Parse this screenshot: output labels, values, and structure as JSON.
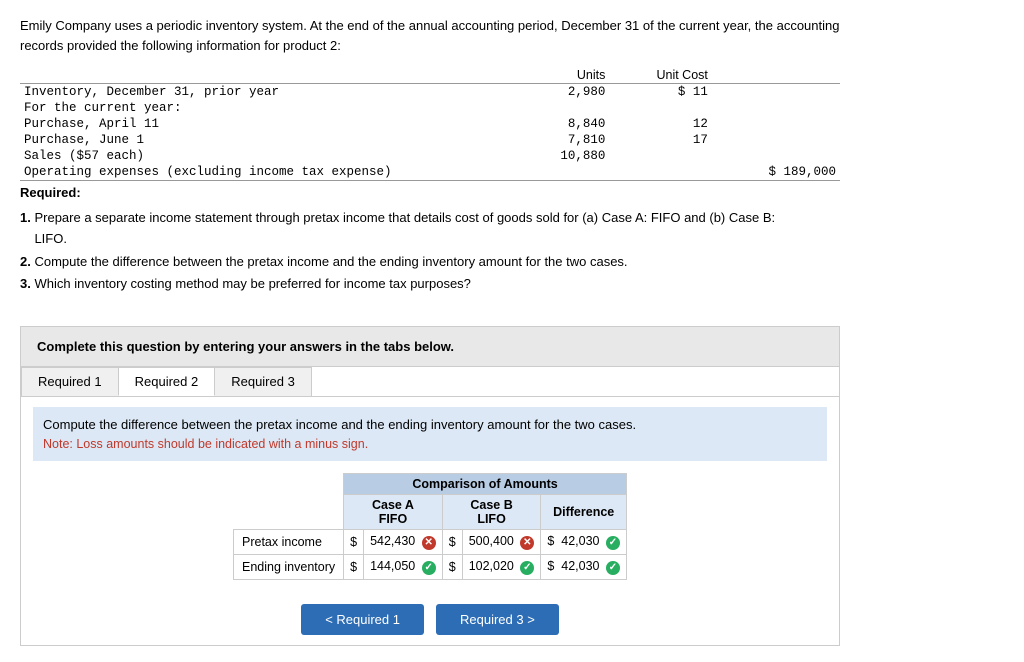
{
  "intro": {
    "text": "Emily Company uses a periodic inventory system. At the end of the annual accounting period, December 31 of the current year, the accounting records provided the following information for product 2:"
  },
  "data_table": {
    "headers": [
      "",
      "Units",
      "Unit Cost"
    ],
    "rows": [
      {
        "label": "Inventory, December 31, prior year",
        "indent": 0,
        "units": "2,980",
        "cost": "$ 11",
        "amount": ""
      },
      {
        "label": "For the current year:",
        "indent": 0,
        "units": "",
        "cost": "",
        "amount": ""
      },
      {
        "label": "Purchase, April 11",
        "indent": 2,
        "units": "8,840",
        "cost": "12",
        "amount": ""
      },
      {
        "label": "Purchase, June 1",
        "indent": 2,
        "units": "7,810",
        "cost": "17",
        "amount": ""
      },
      {
        "label": "Sales ($57 each)",
        "indent": 2,
        "units": "10,880",
        "cost": "",
        "amount": ""
      },
      {
        "label": "Operating expenses (excluding income tax expense)",
        "indent": 2,
        "units": "",
        "cost": "",
        "amount": "$ 189,000"
      }
    ]
  },
  "required_label": "Required:",
  "instructions": [
    {
      "num": "1",
      "text": "Prepare a separate income statement through pretax income that details cost of goods sold for (a) Case A: FIFO and (b) Case B: LIFO."
    },
    {
      "num": "2",
      "text": "Compute the difference between the pretax income and the ending inventory amount for the two cases."
    },
    {
      "num": "3",
      "text": "Which inventory costing method may be preferred for income tax purposes?"
    }
  ],
  "complete_box": {
    "text": "Complete this question by entering your answers in the tabs below."
  },
  "tabs": [
    {
      "label": "Required 1",
      "active": false
    },
    {
      "label": "Required 2",
      "active": true
    },
    {
      "label": "Required 3",
      "active": false
    }
  ],
  "tab_instruction": "Compute the difference between the pretax income and the ending inventory amount for the two cases.",
  "tab_note": "Note: Loss amounts should be indicated with a minus sign.",
  "comparison_table": {
    "title": "Comparison of Amounts",
    "col_a_label": "Case A",
    "col_a_sub": "FIFO",
    "col_b_label": "Case B",
    "col_b_sub": "LIFO",
    "diff_label": "Difference",
    "rows": [
      {
        "label": "Pretax income",
        "col_a_prefix": "$",
        "col_a_value": "542,430",
        "col_a_icon": "x",
        "col_b_prefix": "$",
        "col_b_value": "500,400",
        "col_b_icon": "x",
        "diff_prefix": "$",
        "diff_value": "42,030",
        "diff_icon": "check"
      },
      {
        "label": "Ending inventory",
        "col_a_prefix": "$",
        "col_a_value": "144,050",
        "col_a_icon": "check",
        "col_b_prefix": "$",
        "col_b_value": "102,020",
        "col_b_icon": "check",
        "diff_prefix": "$",
        "diff_value": "42,030",
        "diff_icon": "check"
      }
    ]
  },
  "nav": {
    "prev_label": "< Required 1",
    "next_label": "Required 3 >"
  }
}
